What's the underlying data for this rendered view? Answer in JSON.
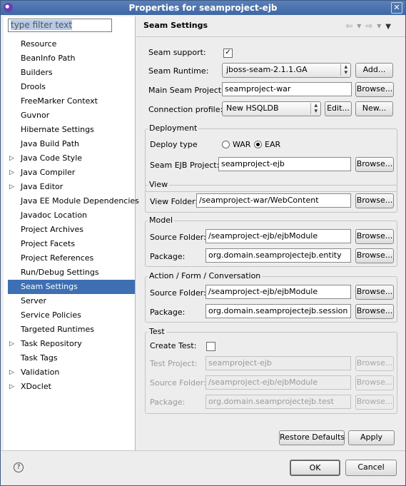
{
  "window": {
    "title": "Properties for seamproject-ejb",
    "close": "✕"
  },
  "filter": {
    "placeholder": "type filter text"
  },
  "tree": [
    {
      "label": "Resource",
      "expandable": false
    },
    {
      "label": "BeanInfo Path",
      "expandable": false
    },
    {
      "label": "Builders",
      "expandable": false
    },
    {
      "label": "Drools",
      "expandable": false
    },
    {
      "label": "FreeMarker Context",
      "expandable": false
    },
    {
      "label": "Guvnor",
      "expandable": false
    },
    {
      "label": "Hibernate Settings",
      "expandable": false
    },
    {
      "label": "Java Build Path",
      "expandable": false
    },
    {
      "label": "Java Code Style",
      "expandable": true
    },
    {
      "label": "Java Compiler",
      "expandable": true
    },
    {
      "label": "Java Editor",
      "expandable": true
    },
    {
      "label": "Java EE Module Dependencies",
      "expandable": false
    },
    {
      "label": "Javadoc Location",
      "expandable": false
    },
    {
      "label": "Project Archives",
      "expandable": false
    },
    {
      "label": "Project Facets",
      "expandable": false
    },
    {
      "label": "Project References",
      "expandable": false
    },
    {
      "label": "Run/Debug Settings",
      "expandable": false
    },
    {
      "label": "Seam Settings",
      "expandable": false,
      "selected": true
    },
    {
      "label": "Server",
      "expandable": false
    },
    {
      "label": "Service Policies",
      "expandable": false
    },
    {
      "label": "Targeted Runtimes",
      "expandable": false
    },
    {
      "label": "Task Repository",
      "expandable": true
    },
    {
      "label": "Task Tags",
      "expandable": false
    },
    {
      "label": "Validation",
      "expandable": true
    },
    {
      "label": "XDoclet",
      "expandable": true
    }
  ],
  "page": {
    "title": "Seam Settings",
    "seam_support_label": "Seam support:",
    "seam_support_checked": true,
    "seam_runtime_label": "Seam Runtime:",
    "seam_runtime_value": "jboss-seam-2.1.1.GA",
    "add_button": "Add...",
    "main_project_label": "Main Seam Project:",
    "main_project_value": "seamproject-war",
    "browse": "Browse...",
    "connection_label": "Connection profile:",
    "connection_value": "New HSQLDB",
    "edit_button": "Edit...",
    "new_button": "New..."
  },
  "deployment": {
    "legend": "Deployment",
    "deploy_type_label": "Deploy type",
    "war_label": "WAR",
    "ear_label": "EAR",
    "selected": "EAR",
    "ejb_project_label": "Seam EJB Project:",
    "ejb_project_value": "seamproject-ejb"
  },
  "view": {
    "legend": "View",
    "folder_label": "View Folder:",
    "folder_value": "/seamproject-war/WebContent"
  },
  "model": {
    "legend": "Model",
    "source_label": "Source Folder:",
    "source_value": "/seamproject-ejb/ejbModule",
    "package_label": "Package:",
    "package_value": "org.domain.seamprojectejb.entity"
  },
  "action": {
    "legend": "Action / Form / Conversation",
    "source_label": "Source Folder:",
    "source_value": "/seamproject-ejb/ejbModule",
    "package_label": "Package:",
    "package_value": "org.domain.seamprojectejb.session"
  },
  "test": {
    "legend": "Test",
    "create_label": "Create Test:",
    "create_checked": false,
    "project_label": "Test Project:",
    "project_value": "seamproject-ejb",
    "source_label": "Source Folder:",
    "source_value": "/seamproject-ejb/ejbModule",
    "package_label": "Package:",
    "package_value": "org.domain.seamprojectejb.test"
  },
  "actions": {
    "restore_defaults": "Restore Defaults",
    "apply": "Apply",
    "ok": "OK",
    "cancel": "Cancel",
    "help": "?"
  }
}
